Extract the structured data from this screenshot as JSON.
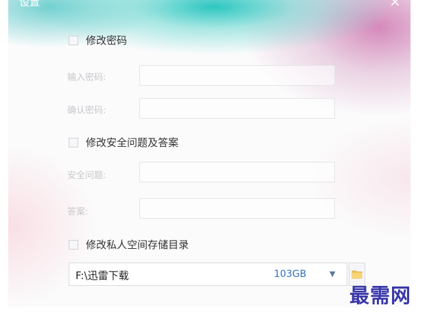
{
  "dialog": {
    "title": "设置",
    "close_glyph": "×"
  },
  "password": {
    "checkbox_label": "修改密码",
    "checked": false,
    "enter_label": "输入密码:",
    "confirm_label": "确认密码:",
    "enter_value": "",
    "confirm_value": ""
  },
  "security": {
    "checkbox_label": "修改安全问题及答案",
    "checked": false,
    "question_label": "安全问题:",
    "answer_label": "答案:",
    "question_value": "",
    "answer_value": ""
  },
  "storage": {
    "checkbox_label": "修改私人空间存储目录",
    "checked": false,
    "path": "F:\\迅雷下载",
    "size": "103GB",
    "dropdown_icon": "chevron-down-icon",
    "browse_icon": "folder-icon"
  },
  "watermark": "最需网",
  "colors": {
    "accent_teal": "#22c4be",
    "accent_pink": "#ce76b0",
    "size_text": "#2f6fb8",
    "watermark": "#3a37a8"
  }
}
